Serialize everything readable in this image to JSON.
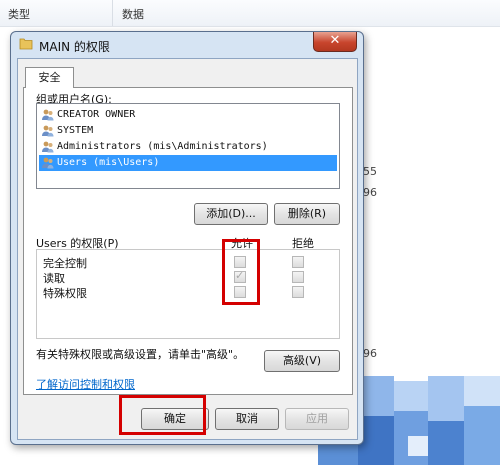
{
  "background": {
    "col_type": "类型",
    "col_data": "数据",
    "right_values": [
      "55",
      "96",
      "96"
    ]
  },
  "dialog": {
    "title": "MAIN 的权限",
    "close_label": "✕",
    "tab": "安全",
    "group_label": "组或用户名(G):",
    "users": [
      "CREATOR OWNER",
      "SYSTEM",
      "Administrators (mis\\Administrators)",
      "Users (mis\\Users)"
    ],
    "selected_user_index": 3,
    "add_button": "添加(D)...",
    "remove_button": "删除(R)",
    "permissions_label": "Users 的权限(P)",
    "allow_header": "允许",
    "deny_header": "拒绝",
    "permissions": [
      {
        "name": "完全控制",
        "allow": false,
        "deny": false
      },
      {
        "name": "读取",
        "allow": true,
        "deny": false
      },
      {
        "name": "特殊权限",
        "allow": false,
        "deny": false
      }
    ],
    "advanced_hint": "有关特殊权限或高级设置，请单击\"高级\"。",
    "advanced_button": "高级(V)",
    "learn_link": "了解访问控制和权限",
    "ok_button": "确定",
    "cancel_button": "取消",
    "apply_button": "应用"
  },
  "colors": {
    "selection": "#3399ff",
    "highlight": "#d40000",
    "link": "#0066cc",
    "frame": "#d6e4f3"
  }
}
